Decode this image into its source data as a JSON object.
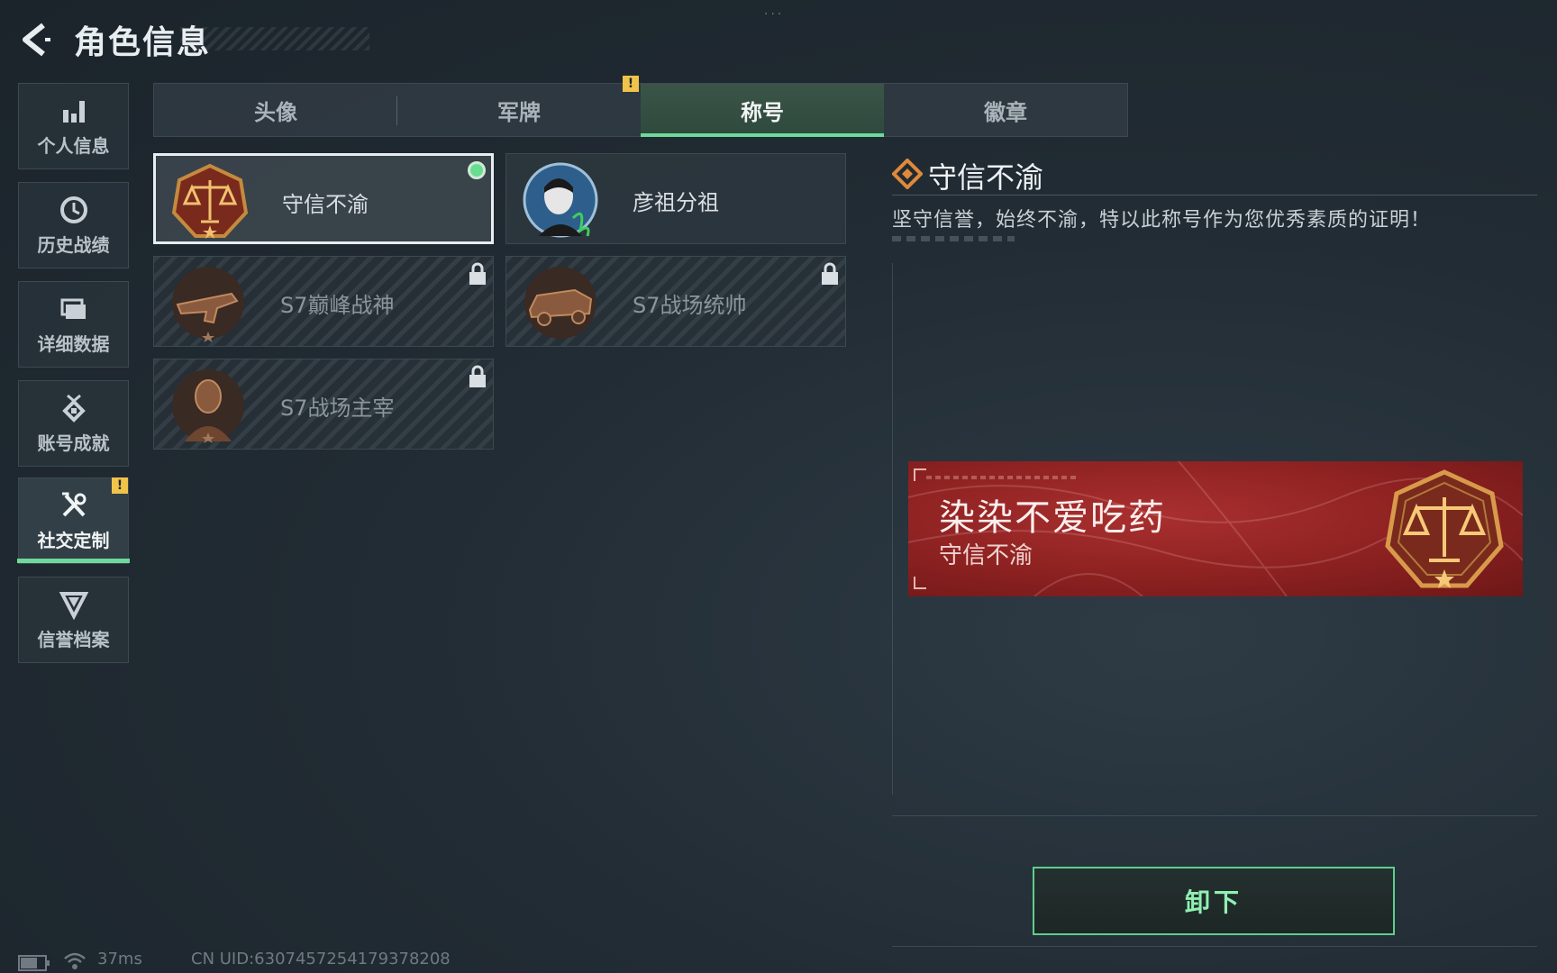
{
  "header": {
    "title": "角色信息"
  },
  "nav": {
    "items": [
      {
        "label": "个人信息",
        "icon": "bar-chart-icon"
      },
      {
        "label": "历史战绩",
        "icon": "clock-icon"
      },
      {
        "label": "详细数据",
        "icon": "folder-icon"
      },
      {
        "label": "账号成就",
        "icon": "medal-icon"
      },
      {
        "label": "社交定制",
        "icon": "wrench-icon",
        "active": true,
        "alert": "!"
      },
      {
        "label": "信誉档案",
        "icon": "shield-icon"
      }
    ]
  },
  "tabs": [
    {
      "label": "头像"
    },
    {
      "label": "军牌",
      "alert": "!"
    },
    {
      "label": "称号",
      "active": true
    },
    {
      "label": "徽章"
    }
  ],
  "titles": [
    {
      "label": "守信不渝",
      "state": "equipped",
      "icon": "scales-emblem-icon"
    },
    {
      "label": "彦祖分祖",
      "state": "unlocked",
      "icon": "portrait-emblem-icon"
    },
    {
      "label": "S7巅峰战神",
      "state": "locked",
      "icon": "gun-emblem-icon"
    },
    {
      "label": "S7战场统帅",
      "state": "locked",
      "icon": "vehicle-emblem-icon"
    },
    {
      "label": "S7战场主宰",
      "state": "locked",
      "icon": "soldier-emblem-icon"
    }
  ],
  "detail": {
    "title": "守信不渝",
    "description": "坚守信誉，始终不渝，特以此称号作为您优秀素质的证明！"
  },
  "nameplate": {
    "player_name": "染染不爱吃药",
    "title": "守信不渝"
  },
  "actions": {
    "unequip_label": "卸下"
  },
  "status": {
    "ping": "37ms",
    "uid": "CN UID:6307457254179378208"
  },
  "colors": {
    "accent": "#6ed99a",
    "alert": "#f0c34a",
    "nameplate_red": "#8f2222"
  }
}
